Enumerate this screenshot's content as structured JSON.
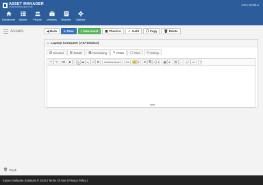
{
  "app": {
    "brand_title": "ASSET MANAGER",
    "brand_subtitle": "ASSETMANAGER.COM",
    "user_menu": "John Smith ▾"
  },
  "nav": [
    {
      "label": "Dashboard",
      "icon": "home-icon"
    },
    {
      "label": "Assets",
      "icon": "list-icon"
    },
    {
      "label": "People",
      "icon": "people-icon"
    },
    {
      "label": "Vendors",
      "icon": "vendors-icon"
    },
    {
      "label": "Reports",
      "icon": "reports-icon"
    },
    {
      "label": "Options",
      "icon": "gear-icon"
    }
  ],
  "page": {
    "title": "Assets"
  },
  "toolbar": {
    "back": "Back",
    "save": "Save",
    "new_asset": "New Asset",
    "check_in": "Check In",
    "audit": "Audit",
    "copy": "Copy",
    "delete": "Delete"
  },
  "asset": {
    "heading": "Laptop Computer (AST000013)"
  },
  "tabs": [
    {
      "label": "General",
      "icon": "general-icon",
      "active": false
    },
    {
      "label": "Details",
      "icon": "details-icon",
      "active": false
    },
    {
      "label": "Purchasing",
      "icon": "purchasing-icon",
      "active": false
    },
    {
      "label": "Notes",
      "icon": "notes-icon",
      "active": true
    },
    {
      "label": "Files",
      "icon": "files-icon",
      "active": false
    },
    {
      "label": "History",
      "icon": "history-icon",
      "active": false
    }
  ],
  "editor": {
    "font_family": "Helvetica Neue",
    "font_size": "11",
    "undo": "↶",
    "redo": "↷",
    "eraser": "⌫",
    "bold": "B",
    "italic": "I",
    "underline": "U",
    "strike": "S",
    "subscript": "x₂",
    "superscript": "x²",
    "paint": "⌘",
    "highlight": "A",
    "bullets": "☰",
    "numbers": "≣",
    "align": "≡",
    "table": "▦",
    "link": "⛓",
    "rule": "—",
    "fullscreen": "⤢",
    "code": "</>",
    "help": "?"
  },
  "sidebar": {
    "trash": "Trash"
  },
  "footer": {
    "text": "Kaizen Software Solutions © 2016 | Terms Of Use | Privacy Policy |"
  },
  "colors": {
    "topbar": "#2c5d9a",
    "primary": "#3b77c0",
    "success": "#5cb85c",
    "footer": "#222222"
  }
}
